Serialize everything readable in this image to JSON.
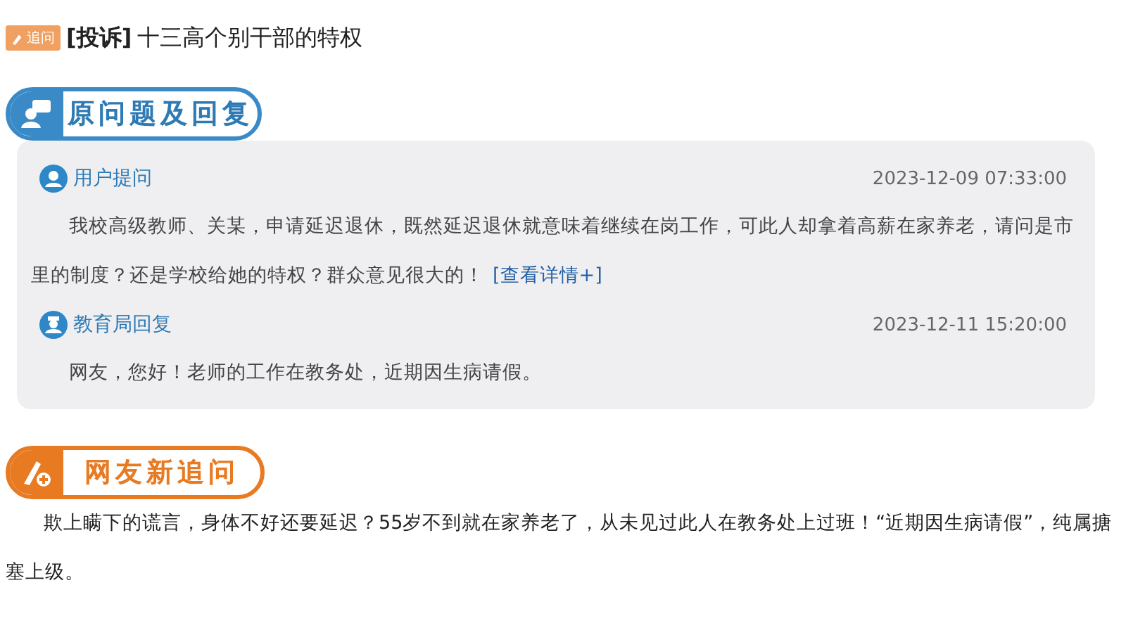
{
  "post": {
    "badge": "追问",
    "category": "[投诉]",
    "title": "十三高个别干部的特权"
  },
  "original_section": {
    "heading": "原问题及回复",
    "entries": [
      {
        "kind": "question",
        "label": "用户提问",
        "time": "2023-12-09 07:33:00",
        "text": "我校高级教师、关某，申请延迟退休，既然延迟退休就意味着继续在岗工作，可此人却拿着高薪在家养老，请问是市里的制度？还是学校给她的特权？群众意见很大的！",
        "link": "[查看详情+]"
      },
      {
        "kind": "reply",
        "label": "教育局回复",
        "time": "2023-12-11 15:20:00",
        "text": "网友，您好！老师的工作在教务处，近期因生病请假。"
      }
    ]
  },
  "followup_section": {
    "heading": "网友新追问",
    "text": "欺上瞒下的谎言，身体不好还要延迟？55岁不到就在家养老了，从未见过此人在教务处上过班！“近期因生病请假”，纯属搪塞上级。"
  }
}
